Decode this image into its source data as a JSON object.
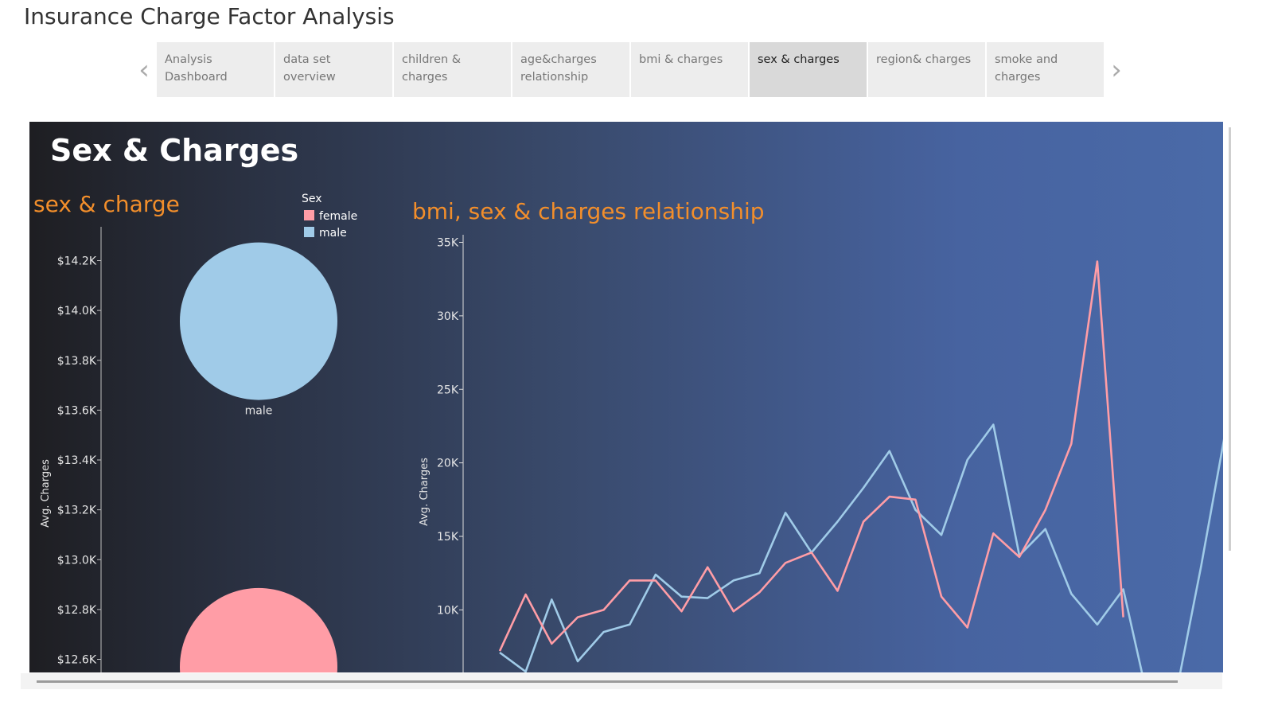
{
  "app": {
    "title": "Insurance Charge Factor Analysis"
  },
  "tabs": [
    {
      "label": "Analysis\nDashboard",
      "active": false
    },
    {
      "label": "data set overview",
      "active": false
    },
    {
      "label": "children & charges",
      "active": false
    },
    {
      "label": "age&charges\nrelationship",
      "active": false
    },
    {
      "label": "bmi  & charges",
      "active": false
    },
    {
      "label": "sex & charges",
      "active": true
    },
    {
      "label": "region& charges",
      "active": false
    },
    {
      "label": "smoke and\ncharges",
      "active": false
    }
  ],
  "nav": {
    "prev_icon": "chevron-left-icon",
    "next_icon": "chevron-right-icon"
  },
  "dashboard": {
    "title": "Sex & Charges"
  },
  "colors": {
    "female": "#ff9da6",
    "male": "#a0cbe8",
    "accent_orange": "#f28e2b",
    "axis_text": "#e6e6e6"
  },
  "chart_data": [
    {
      "type": "scatter",
      "title": "sex & charge",
      "ylabel": "Avg. Charges",
      "ylim": [
        12550,
        14330
      ],
      "yticks": [
        12600,
        12800,
        13000,
        13200,
        13400,
        13600,
        13800,
        14000,
        14200
      ],
      "ytick_labels": [
        "$12.6K",
        "$12.8K",
        "$13.0K",
        "$13.2K",
        "$13.4K",
        "$13.6K",
        "$13.8K",
        "$14.0K",
        "$14.2K"
      ],
      "legend": {
        "title": "Sex",
        "position": "top-right",
        "entries": [
          "female",
          "male"
        ]
      },
      "points": [
        {
          "sex": "male",
          "value": 13957,
          "label": "male"
        },
        {
          "sex": "female",
          "value": 12570,
          "label": ""
        }
      ]
    },
    {
      "type": "line",
      "title": "bmi, sex & charges relationship",
      "ylabel": "Avg. Charges",
      "ylim": [
        7000,
        35400
      ],
      "yticks": [
        10000,
        15000,
        20000,
        25000,
        30000,
        35000
      ],
      "ytick_labels": [
        "10K",
        "15K",
        "20K",
        "25K",
        "30K",
        "35K"
      ],
      "x": [
        1,
        2,
        3,
        4,
        5,
        6,
        7,
        8,
        9,
        10,
        11,
        12,
        13,
        14,
        15,
        16,
        17,
        18,
        19,
        20,
        21,
        22,
        23,
        24,
        25,
        26,
        27,
        28,
        29
      ],
      "series": [
        {
          "name": "female",
          "values": [
            7200,
            11050,
            7700,
            9500,
            10000,
            12000,
            12000,
            9900,
            12900,
            9900,
            11200,
            13200,
            13900,
            11300,
            16000,
            17700,
            17500,
            10900,
            8800,
            15200,
            13600,
            16800,
            21300,
            33700,
            9500,
            null,
            null,
            null,
            null
          ]
        },
        {
          "name": "male",
          "values": [
            7100,
            5800,
            10700,
            6500,
            8500,
            9000,
            12400,
            10900,
            10800,
            12000,
            12500,
            16600,
            13900,
            16000,
            18300,
            20800,
            16800,
            15100,
            20200,
            22600,
            13700,
            15500,
            11100,
            9000,
            11400,
            3500,
            4000,
            13000,
            22800
          ]
        }
      ]
    }
  ]
}
